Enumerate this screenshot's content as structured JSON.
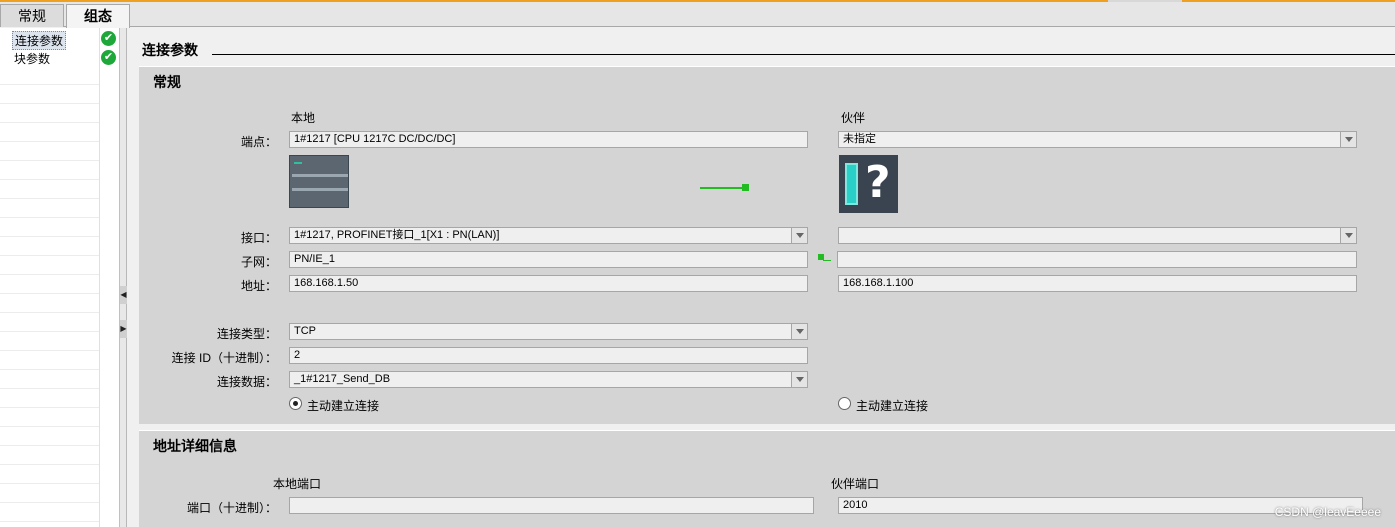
{
  "tabs": [
    {
      "label": "常规"
    },
    {
      "label": "组态"
    }
  ],
  "nav": {
    "items": [
      {
        "label": "连接参数"
      },
      {
        "label": "块参数"
      }
    ],
    "check_glyph": "✔"
  },
  "header": {
    "title": "连接参数"
  },
  "general": {
    "title": "常规",
    "local_label": "本地",
    "partner_label": "伙伴",
    "endpoint_label": "端点：",
    "endpoint_local": "1#1217 [CPU 1217C DC/DC/DC]",
    "endpoint_partner": "未指定",
    "interface_label": "接口：",
    "interface_local": "1#1217, PROFINET接口_1[X1 : PN(LAN)]",
    "interface_partner": "",
    "subnet_label": "子网：",
    "subnet_local": "PN/IE_1",
    "subnet_partner": "",
    "address_label": "地址：",
    "address_local": "168.168.1.50",
    "address_partner": "168.168.1.100",
    "conn_type_label": "连接类型：",
    "conn_type_value": "TCP",
    "conn_id_label": "连接 ID（十进制）：",
    "conn_id_value": "2",
    "conn_data_label": "连接数据：",
    "conn_data_value": "_1#1217_Send_DB",
    "active_local_label": "主动建立连接",
    "active_partner_label": "主动建立连接",
    "active_local_selected": true,
    "active_partner_selected": false,
    "partner_unknown_glyph": "?"
  },
  "address_details": {
    "title": "地址详细信息",
    "local_port_label": "本地端口",
    "partner_port_label": "伙伴端口",
    "port_label": "端口（十进制）：",
    "local_port_value": "",
    "partner_port_value": "2010"
  },
  "watermark": "CSDN @leavEeeee",
  "colors": {
    "accent_orange": "#f0a020",
    "check_green": "#1fa83a",
    "connection_green": "#22bb22",
    "section_bg": "#d4d4d4"
  },
  "icons": {
    "check": "check-circle-icon",
    "dropdown": "chevron-down-icon",
    "splitter_left": "arrow-left-icon",
    "splitter_right": "arrow-right-icon"
  }
}
